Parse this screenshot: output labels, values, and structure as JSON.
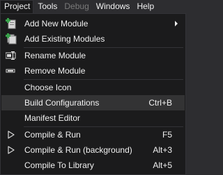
{
  "menubar": {
    "items": [
      {
        "label": "Project"
      },
      {
        "label": "Tools"
      },
      {
        "label": "Debug"
      },
      {
        "label": "Windows"
      },
      {
        "label": "Help"
      }
    ]
  },
  "menu": {
    "items": [
      {
        "label": "Add New Module",
        "icon": "add-new-module-icon",
        "shortcut": ""
      },
      {
        "label": "Add Existing Modules",
        "icon": "add-existing-modules-icon",
        "shortcut": ""
      },
      {
        "label": "Rename Module",
        "icon": "rename-module-icon",
        "shortcut": ""
      },
      {
        "label": "Remove Module",
        "icon": "remove-module-icon",
        "shortcut": ""
      },
      {
        "label": "Choose Icon",
        "icon": "",
        "shortcut": ""
      },
      {
        "label": "Build Configurations",
        "icon": "",
        "shortcut": "Ctrl+B"
      },
      {
        "label": "Manifest Editor",
        "icon": "",
        "shortcut": ""
      },
      {
        "label": "Compile & Run",
        "icon": "play-icon",
        "shortcut": "F5"
      },
      {
        "label": "Compile & Run (background)",
        "icon": "play-icon",
        "shortcut": "Alt+3"
      },
      {
        "label": "Compile To Library",
        "icon": "",
        "shortcut": "Alt+5"
      }
    ]
  },
  "colors": {
    "background": "#2d2d30",
    "menu_background": "#1b1b1c",
    "hover": "#333334",
    "text": "#f1f1f1",
    "disabled_text": "#7a7a7a",
    "icon_green": "#38a14a"
  }
}
